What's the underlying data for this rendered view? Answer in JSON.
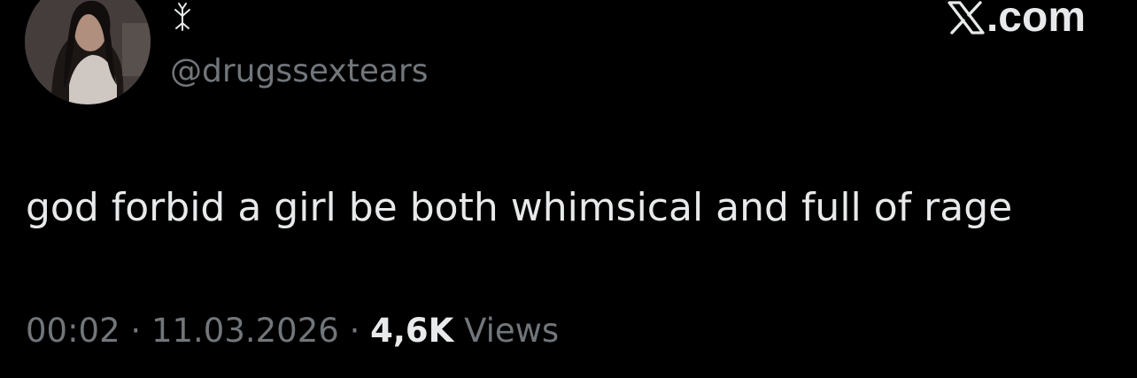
{
  "account": {
    "handle": "@drugssextears",
    "avatar_icon": "profile-photo",
    "name_icon": "tree-glyph-icon"
  },
  "brand": {
    "text": ".com",
    "icon": "x-logo-icon"
  },
  "tweet": {
    "text": "god forbid a girl be both whimsical and full of rage",
    "time": "00:02",
    "date": "11.03.2026",
    "separator": "·",
    "views_count": "4,6K",
    "views_label": "Views"
  },
  "colors": {
    "background": "#000000",
    "primary_text": "#e7e9ea",
    "secondary_text": "#71767b"
  }
}
